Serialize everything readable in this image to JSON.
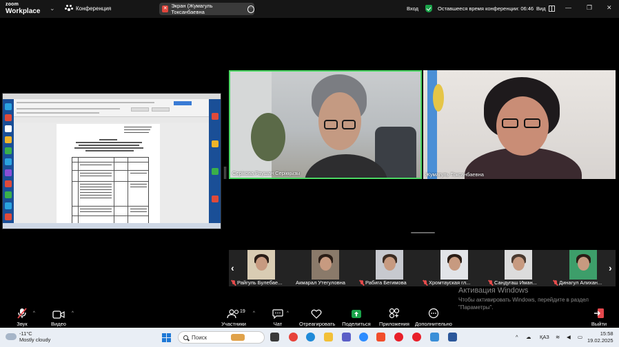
{
  "titlebar": {
    "logo_top": "zoom",
    "logo_bottom": "Workplace",
    "conference_label": "Конференция",
    "screen_share_label": "Экран (Жумагуль Токсанбаевна",
    "signin_label": "Вход",
    "time_left_label": "Оставшееся время конференции: 06:46",
    "view_label": "Вид",
    "accent_color": "#1aa34a"
  },
  "tiles": {
    "main": [
      {
        "name": "Серікова Раушан Серікқызы",
        "active_speaker": true
      },
      {
        "name": "Жумагуль Токсанбаевна",
        "active_speaker": false
      }
    ]
  },
  "gallery": {
    "participants": [
      {
        "name": "Райгуль Булебае...",
        "muted": true
      },
      {
        "name": "Акмарал Утегуловна",
        "muted": false
      },
      {
        "name": "Рабига Бегимова",
        "muted": true
      },
      {
        "name": "Хромтауская гл...",
        "muted": true
      },
      {
        "name": "Сандугаш Иман...",
        "muted": true
      },
      {
        "name": "Динагул Алихан...",
        "muted": true
      }
    ]
  },
  "activation": {
    "heading": "Активация Windows",
    "text": "Чтобы активировать Windows, перейдите в раздел \"Параметры\"."
  },
  "toolbar": {
    "audio_label": "Звук",
    "video_label": "Видео",
    "participants_label": "Участники",
    "participants_count": "19",
    "chat_label": "Чат",
    "react_label": "Отреагировать",
    "share_label": "Поделиться",
    "apps_label": "Приложения",
    "more_label": "Дополнительно",
    "leave_label": "Выйти",
    "share_color": "#1aa34a",
    "leave_color": "#e5484d"
  },
  "taskbar": {
    "temperature": "-11°C",
    "weather": "Mostly cloudy",
    "search_placeholder": "Поиск",
    "language": "ҚАЗ",
    "time": "15:58",
    "date": "19.02.2025"
  }
}
